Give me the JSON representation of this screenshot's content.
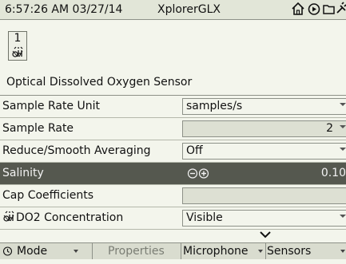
{
  "status_bar": {
    "time": "6:57:26 AM",
    "date": "03/27/14",
    "app_title": "XplorerGLX"
  },
  "sensor": {
    "number": "1",
    "name": "Optical Dissolved Oxygen Sensor"
  },
  "properties": [
    {
      "label": "Sample Rate Unit",
      "value": "samples/s",
      "has_dropdown": true
    },
    {
      "label": "Sample Rate",
      "value": "2",
      "has_dropdown": true
    },
    {
      "label": "Reduce/Smooth Averaging",
      "value": "Off",
      "has_dropdown": true
    },
    {
      "label": "Salinity",
      "value": "0.10",
      "selected": true,
      "stepper_icons": "minus-plus"
    },
    {
      "label": "Cap Coefficients",
      "value": ""
    },
    {
      "label": "DO2 Concentration",
      "value": "Visible",
      "has_dropdown": true,
      "label_icon": "sensor-icon"
    }
  ],
  "softkeys": {
    "mode": "Mode",
    "properties": "Properties",
    "microphone": "Microphone",
    "sensors": "Sensors"
  },
  "colors": {
    "background": "#f3f5ec",
    "selected_row": "#55584f",
    "title_bar": "#e2e6d8"
  }
}
